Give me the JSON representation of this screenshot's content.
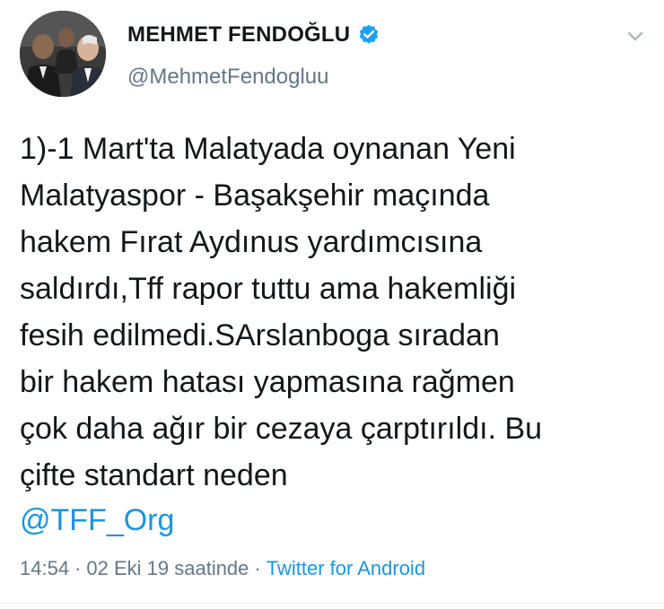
{
  "author": {
    "display_name": "MEHMET FENDOĞLU",
    "handle": "@MehmetFendogluu",
    "verified": true
  },
  "tweet": {
    "text": "1)-1 Mart'ta Malatyada oynanan Yeni\nMalatyaspor - Başakşehir maçında\nhakem Fırat Aydınus yardımcısına\nsaldırdı,Tff rapor tuttu ama hakemliği\nfesih edilmedi.SArslanboga sıradan\nbir hakem hatası yapmasına rağmen\nçok daha ağır bir cezaya çarptırıldı. Bu\nçifte standart neden",
    "mention": "@TFF_Org"
  },
  "meta": {
    "time": "14:54",
    "separator_1": "·",
    "date": "02 Eki 19 saatinde",
    "separator_2": "·",
    "source": "Twitter for Android"
  },
  "colors": {
    "text": "#14171a",
    "secondary": "#657786",
    "link": "#1b95e0",
    "divider": "#e6ecf0"
  },
  "icons": {
    "verified": "verified-badge-icon",
    "menu": "chevron-down-icon"
  }
}
